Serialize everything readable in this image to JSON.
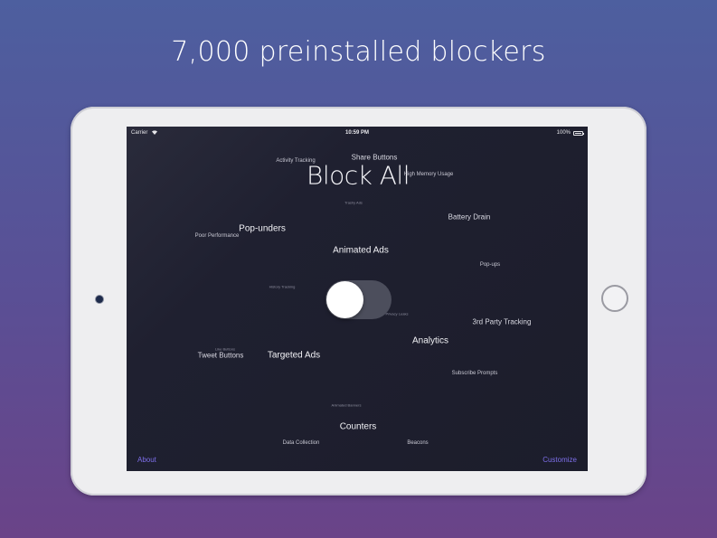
{
  "headline": "7,000 preinstalled blockers",
  "status_bar": {
    "carrier": "Carrier",
    "time": "10:59 PM",
    "battery": "100%"
  },
  "block_all_label": "Block All",
  "tags": {
    "share_buttons": "Share Buttons",
    "activity_tracking": "Activity Tracking",
    "high_memory_usage": "High Memory Usage",
    "trashy_ads": "Trashy Ads",
    "battery_drain": "Battery Drain",
    "pop_unders": "Pop-unders",
    "poor_performance": "Poor Performance",
    "animated_ads": "Animated Ads",
    "pop_ups": "Pop-ups",
    "history_tracking": "History Tracking",
    "privacy_leaks": "Privacy Leaks",
    "third_party_tracking": "3rd Party Tracking",
    "analytics": "Analytics",
    "like_buttons": "Like Buttons",
    "tweet_buttons": "Tweet Buttons",
    "targeted_ads": "Targeted Ads",
    "subscribe_prompts": "Subscribe Prompts",
    "animated_banners": "Animated Banners",
    "counters": "Counters",
    "data_collection": "Data Collection",
    "beacons": "Beacons"
  },
  "toggle_state": "off",
  "footer": {
    "about": "About",
    "customize": "Customize"
  },
  "colors": {
    "accent": "#7c6ee8",
    "screen_bg": "#1f2030",
    "background_top": "#4d5f9f",
    "background_bottom": "#6a4388"
  }
}
